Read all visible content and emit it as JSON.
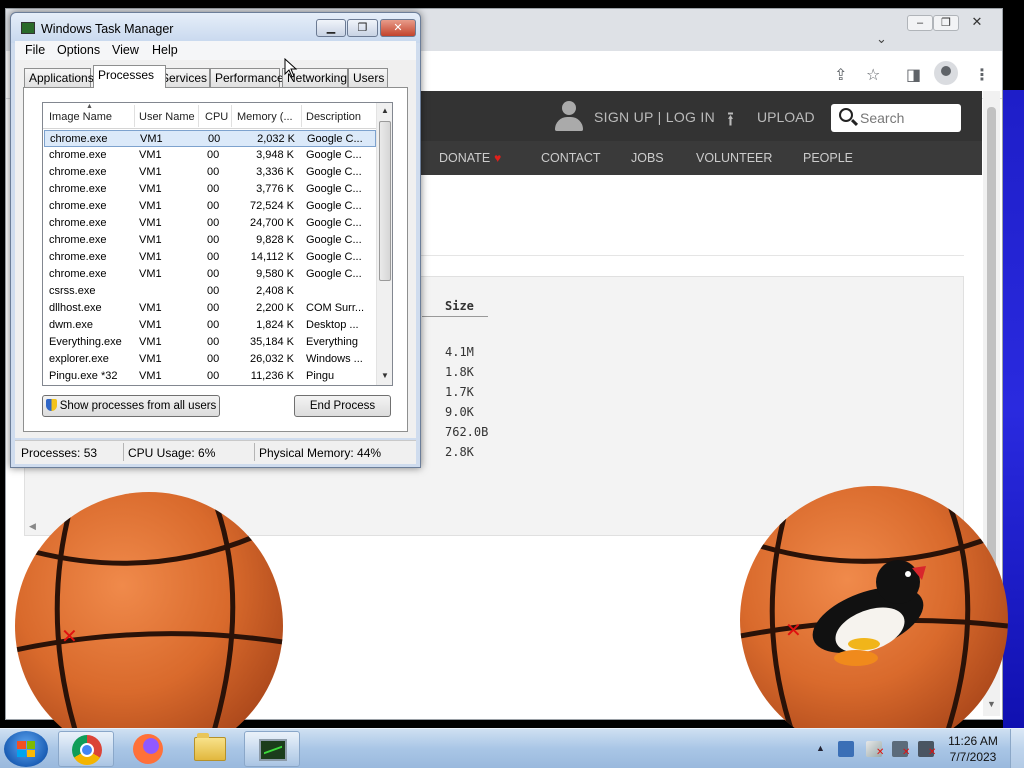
{
  "browser": {
    "menu_glyph": "⋮",
    "site": {
      "signup_label": "SIGN UP | LOG IN",
      "upload_label": "UPLOAD",
      "search_placeholder": "Search",
      "nav": [
        {
          "label": "DONATE"
        },
        {
          "label": "CONTACT"
        },
        {
          "label": "JOBS"
        },
        {
          "label": "VOLUNTEER"
        },
        {
          "label": "PEOPLE"
        }
      ],
      "files": {
        "size_header": "Size",
        "sizes": [
          "4.1M",
          "1.8K",
          "1.7K",
          "9.0K",
          "762.0B",
          "2.8K"
        ]
      }
    }
  },
  "taskmgr": {
    "title": "Windows Task Manager",
    "menu": [
      "File",
      "Options",
      "View",
      "Help"
    ],
    "tabs": [
      "Applications",
      "Processes",
      "Services",
      "Performance",
      "Networking",
      "Users"
    ],
    "active_tab": "Processes",
    "columns": [
      "Image Name",
      "User Name",
      "CPU",
      "Memory (...",
      "Description"
    ],
    "processes": [
      {
        "name": "chrome.exe",
        "user": "VM1",
        "cpu": "00",
        "mem": "2,032 K",
        "desc": "Google C...",
        "selected": true
      },
      {
        "name": "chrome.exe",
        "user": "VM1",
        "cpu": "00",
        "mem": "3,948 K",
        "desc": "Google C..."
      },
      {
        "name": "chrome.exe",
        "user": "VM1",
        "cpu": "00",
        "mem": "3,336 K",
        "desc": "Google C..."
      },
      {
        "name": "chrome.exe",
        "user": "VM1",
        "cpu": "00",
        "mem": "3,776 K",
        "desc": "Google C..."
      },
      {
        "name": "chrome.exe",
        "user": "VM1",
        "cpu": "00",
        "mem": "72,524 K",
        "desc": "Google C..."
      },
      {
        "name": "chrome.exe",
        "user": "VM1",
        "cpu": "00",
        "mem": "24,700 K",
        "desc": "Google C..."
      },
      {
        "name": "chrome.exe",
        "user": "VM1",
        "cpu": "00",
        "mem": "9,828 K",
        "desc": "Google C..."
      },
      {
        "name": "chrome.exe",
        "user": "VM1",
        "cpu": "00",
        "mem": "14,112 K",
        "desc": "Google C..."
      },
      {
        "name": "chrome.exe",
        "user": "VM1",
        "cpu": "00",
        "mem": "9,580 K",
        "desc": "Google C..."
      },
      {
        "name": "csrss.exe",
        "user": "",
        "cpu": "00",
        "mem": "2,408 K",
        "desc": ""
      },
      {
        "name": "dllhost.exe",
        "user": "VM1",
        "cpu": "00",
        "mem": "2,200 K",
        "desc": "COM Surr..."
      },
      {
        "name": "dwm.exe",
        "user": "VM1",
        "cpu": "00",
        "mem": "1,824 K",
        "desc": "Desktop ..."
      },
      {
        "name": "Everything.exe",
        "user": "VM1",
        "cpu": "00",
        "mem": "35,184 K",
        "desc": "Everything"
      },
      {
        "name": "explorer.exe",
        "user": "VM1",
        "cpu": "00",
        "mem": "26,032 K",
        "desc": "Windows ..."
      },
      {
        "name": "Pingu.exe *32",
        "user": "VM1",
        "cpu": "00",
        "mem": "11,236 K",
        "desc": "Pingu"
      }
    ],
    "show_all_label": "Show processes from all users",
    "end_process_label": "End Process",
    "status": {
      "processes": "Processes: 53",
      "cpu": "CPU Usage: 6%",
      "memory": "Physical Memory: 44%"
    }
  },
  "taskbar": {
    "time": "11:26 AM",
    "date": "7/7/2023"
  },
  "colors": {
    "accent": "#333333",
    "heart": "#e0201b",
    "selection": "#dbe9f9"
  }
}
